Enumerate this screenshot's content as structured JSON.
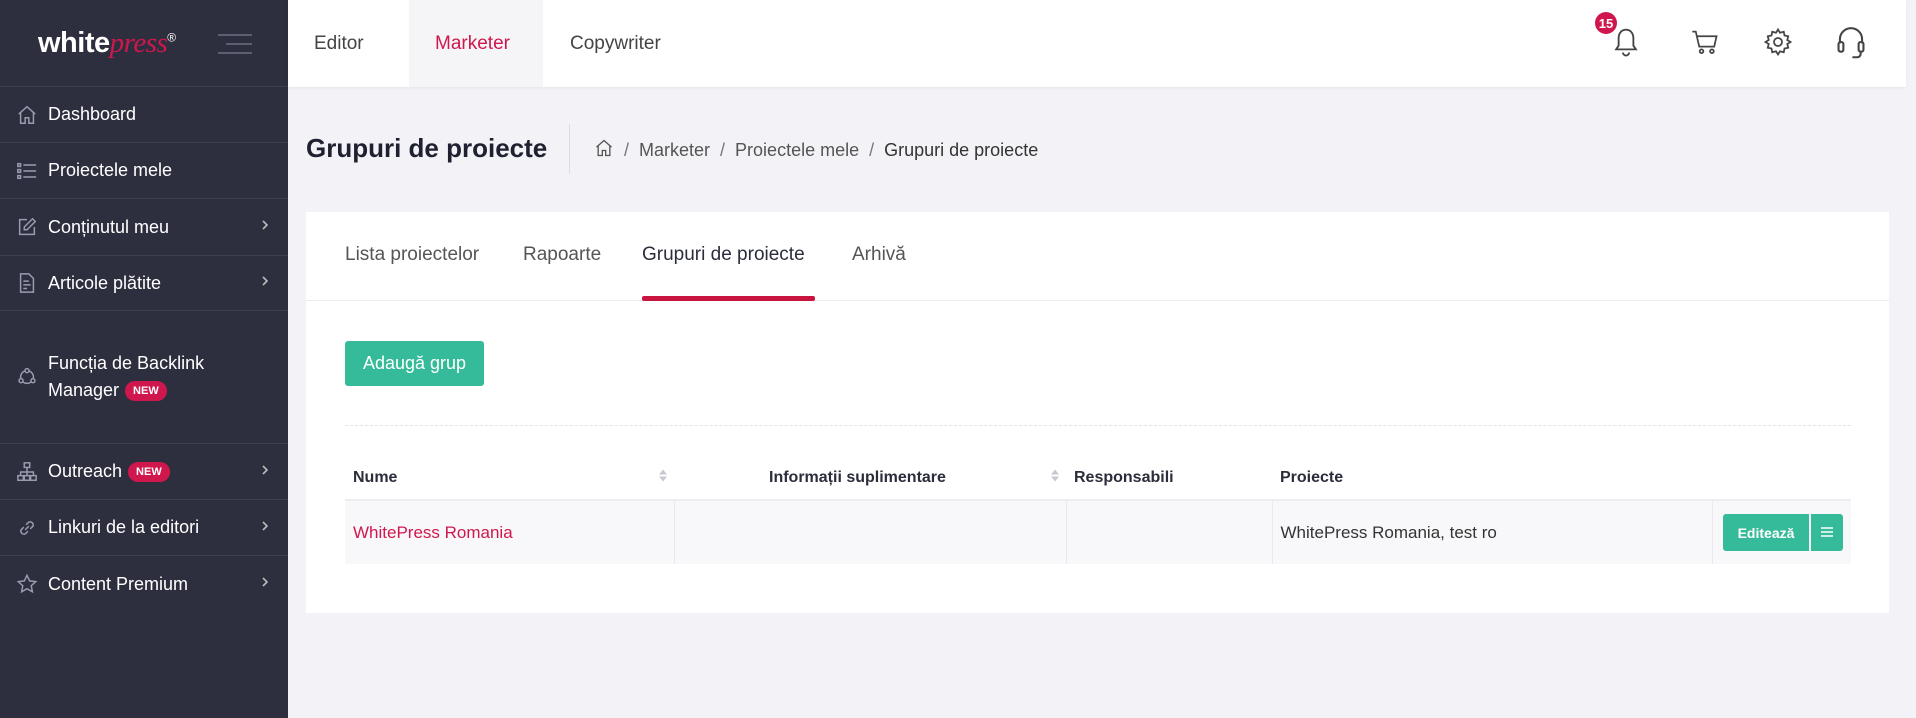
{
  "brand": {
    "logo_white": "white",
    "logo_press": "press",
    "logo_reg": "®"
  },
  "sidebar": {
    "items": [
      {
        "label": "Dashboard",
        "icon": "home-icon"
      },
      {
        "label": "Proiectele mele",
        "icon": "list-icon"
      },
      {
        "label": "Conținutul meu",
        "icon": "edit-icon"
      },
      {
        "label": "Articole plătite",
        "icon": "document-icon"
      },
      {
        "label": "Funcția de Backlink Manager",
        "label_line1": "Funcția de Backlink",
        "label_line2": "Manager",
        "icon": "network-icon",
        "badge": "NEW"
      },
      {
        "label": "Outreach",
        "icon": "sitemap-icon",
        "badge": "NEW"
      },
      {
        "label": "Linkuri de la editori",
        "icon": "link-icon"
      },
      {
        "label": "Content Premium",
        "icon": "star-icon"
      }
    ]
  },
  "topbar": {
    "tabs": [
      {
        "label": "Editor"
      },
      {
        "label": "Marketer"
      },
      {
        "label": "Copywriter"
      }
    ],
    "active_tab": "Marketer",
    "notifications_count": "15"
  },
  "page": {
    "title": "Grupuri de proiecte",
    "breadcrumb": [
      "Marketer",
      "Proiectele mele",
      "Grupuri de proiecte"
    ]
  },
  "card": {
    "tabs": [
      {
        "label": "Lista proiectelor"
      },
      {
        "label": "Rapoarte"
      },
      {
        "label": "Grupuri de proiecte"
      },
      {
        "label": "Arhivă"
      }
    ],
    "active_tab": "Grupuri de proiecte",
    "add_button": "Adaugă grup",
    "table": {
      "headers": [
        "Nume",
        "Informații suplimentare",
        "Responsabili",
        "Proiecte"
      ],
      "rows": [
        {
          "name": "WhitePress Romania",
          "info": "",
          "responsible": "",
          "projects": "WhitePress Romania, test ro",
          "edit": "Editează"
        }
      ]
    }
  },
  "colors": {
    "accent": "#d0174d",
    "green": "#36bb9a",
    "sidebar_bg": "#2d2f3f"
  }
}
